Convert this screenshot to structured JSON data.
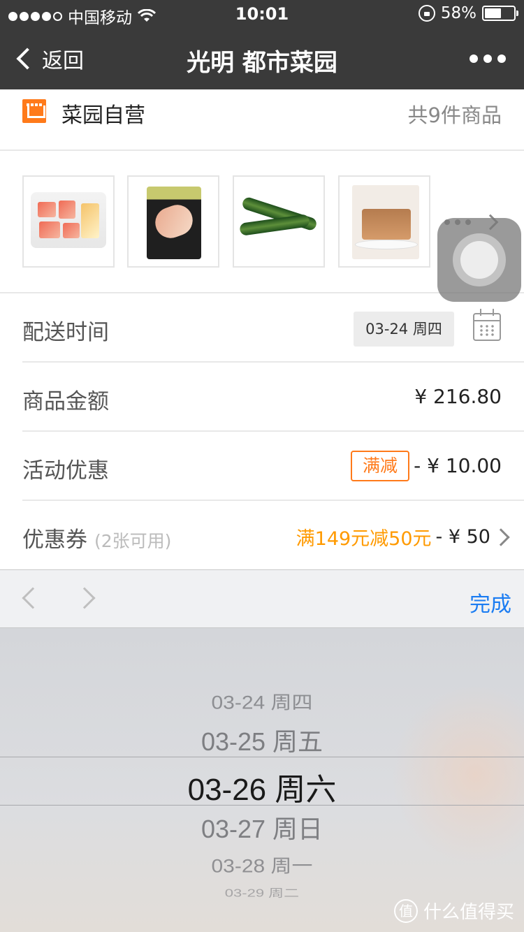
{
  "status_bar": {
    "carrier": "中国移动",
    "time": "10:01",
    "battery_percent": "58%",
    "battery_level": 0.58
  },
  "nav": {
    "back_label": "返回",
    "title": "光明 都市菜园"
  },
  "store": {
    "name": "菜园自营",
    "item_count": "共9件商品"
  },
  "products": [
    {
      "icon": "meat-tray-product-image"
    },
    {
      "icon": "packaged-meat-product-image"
    },
    {
      "icon": "cucumber-product-image"
    },
    {
      "icon": "pancake-product-image"
    }
  ],
  "delivery": {
    "label": "配送时间",
    "date": "03-24 周四"
  },
  "amount": {
    "label": "商品金额",
    "value": "¥ 216.80"
  },
  "promotion": {
    "label": "活动优惠",
    "tag": "满减",
    "value": "- ¥ 10.00"
  },
  "coupon": {
    "label": "优惠券",
    "available": "(2张可用)",
    "promo": "满149元减50元",
    "value": "- ¥ 50"
  },
  "accessory": {
    "done_label": "完成"
  },
  "picker": {
    "options": [
      "03-24 周四",
      "03-25 周五",
      "03-26 周六",
      "03-27 周日",
      "03-28 周一",
      "03-29 周二"
    ],
    "selected": "03-26 周六"
  },
  "watermark": {
    "icon_text": "值",
    "text": "什么值得买"
  },
  "colors": {
    "nav_bg": "#3a3a3a",
    "accent_orange": "#ff7a1a",
    "promo_text": "#ff9a00",
    "done_blue": "#1a7cf2"
  }
}
